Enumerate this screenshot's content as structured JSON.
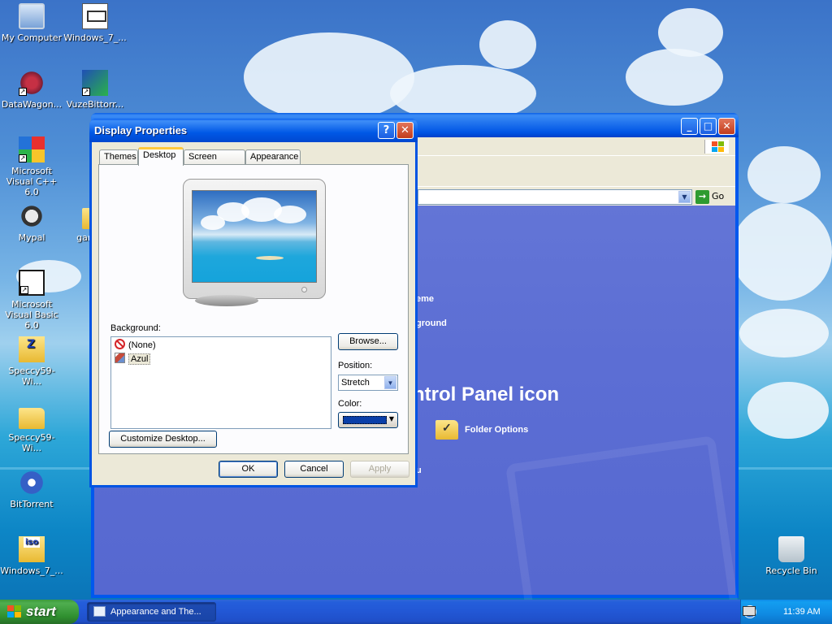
{
  "desktop_icons": [
    {
      "label": "My Computer",
      "icon": "computer-icon"
    },
    {
      "label": "Windows_7_...",
      "icon": "document-icon"
    },
    {
      "label": "DataWagon...",
      "icon": "datawagon-icon"
    },
    {
      "label": "VuzeBittorr...",
      "icon": "vuze-icon"
    },
    {
      "label": "Microsoft Visual C++ 6.0",
      "icon": "visual-cpp-icon"
    },
    {
      "label": "Mypal",
      "icon": "mypal-icon"
    },
    {
      "label": "game-...",
      "icon": "folder-icon"
    },
    {
      "label": "Microsoft Visual Basic 6.0",
      "icon": "visual-basic-icon"
    },
    {
      "label": "Speccy59-Wi...",
      "icon": "zip-icon"
    },
    {
      "label": "Speccy59-Wi...",
      "icon": "folder-icon"
    },
    {
      "label": "BitTorrent",
      "icon": "bittorrent-icon"
    },
    {
      "label": "Windows_7_...",
      "icon": "iso-icon"
    },
    {
      "label": "Recycle Bin",
      "icon": "recycle-bin-icon"
    }
  ],
  "background_window": {
    "address_go": "Go",
    "content_lines": [
      "eme",
      "ground",
      "ntrol Panel icon",
      "u"
    ],
    "folder_options": "Folder Options"
  },
  "dialog": {
    "title": "Display Properties",
    "tabs": [
      "Themes",
      "Desktop",
      "Screen Saver",
      "Appearance"
    ],
    "active_tab": "Desktop",
    "background_label": "Background:",
    "background_items": [
      "(None)",
      "Azul"
    ],
    "selected_background": "Azul",
    "browse_button": "Browse...",
    "position_label": "Position:",
    "position_value": "Stretch",
    "color_label": "Color:",
    "color_value": "#0a3fa8",
    "customize_button": "Customize Desktop...",
    "ok_button": "OK",
    "cancel_button": "Cancel",
    "apply_button": "Apply"
  },
  "taskbar": {
    "start_label": "start",
    "task_items": [
      "Appearance and The..."
    ],
    "clock": "11:39 AM"
  }
}
